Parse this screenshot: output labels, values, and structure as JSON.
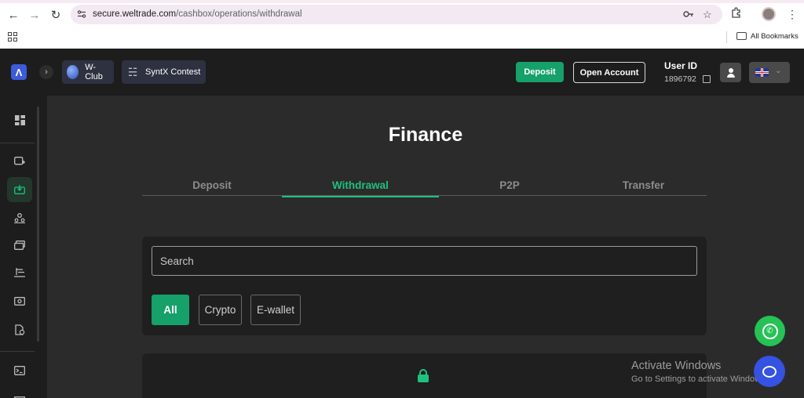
{
  "browser": {
    "url_domain": "secure.weltrade.com",
    "url_path": "/cashbox/operations/withdrawal",
    "bookmarks_label": "All Bookmarks",
    "icons": {
      "back": "back-arrow-icon",
      "forward": "forward-arrow-icon",
      "reload": "reload-icon",
      "site_info": "tune-icon",
      "password": "key-icon",
      "star": "star-icon",
      "extensions": "puzzle-icon",
      "menu": "kebab-icon"
    }
  },
  "header": {
    "chips": [
      {
        "label": "W-Club",
        "icon": "globe-icon"
      },
      {
        "label": "SyntX Contest",
        "icon": "trophy-icon"
      }
    ],
    "deposit_label": "Deposit",
    "open_account_label": "Open Account",
    "user_id_label": "User ID",
    "user_id_value": "1896792",
    "language": "en-GB",
    "colors": {
      "accent": "#16a06a",
      "chip_bg": "#2e3140"
    }
  },
  "sidebar": {
    "items": [
      {
        "icon": "dashboard-icon",
        "active": false
      },
      {
        "icon": "wallet-add-icon",
        "active": false
      },
      {
        "icon": "cashbox-icon",
        "active": true
      },
      {
        "icon": "partners-icon",
        "active": false
      },
      {
        "icon": "cards-icon",
        "active": false
      },
      {
        "icon": "trading-icon",
        "active": false
      },
      {
        "icon": "cash-icon",
        "active": false
      },
      {
        "icon": "document-icon",
        "active": false
      },
      {
        "icon": "terminal-icon",
        "active": false
      }
    ]
  },
  "main": {
    "title": "Finance",
    "tabs": [
      {
        "label": "Deposit",
        "active": false
      },
      {
        "label": "Withdrawal",
        "active": true
      },
      {
        "label": "P2P",
        "active": false
      },
      {
        "label": "Transfer",
        "active": false
      }
    ],
    "search_placeholder": "Search",
    "filters": [
      {
        "label": "All",
        "active": true
      },
      {
        "label": "Crypto",
        "active": false
      },
      {
        "label": "E-wallet",
        "active": false
      }
    ]
  },
  "watermark": {
    "title": "Activate Windows",
    "subtitle": "Go to Settings to activate Windows."
  },
  "floating": {
    "whatsapp_icon": "whatsapp-icon",
    "chat_icon": "chat-icon"
  }
}
